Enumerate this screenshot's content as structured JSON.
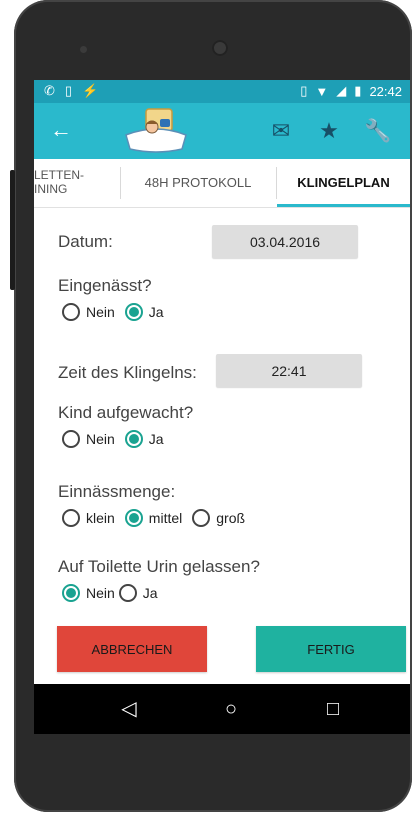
{
  "status_bar": {
    "time": "22:42",
    "left_icons": [
      "call-forward-icon",
      "sd-card-icon",
      "no-flash-icon"
    ],
    "right_icons": [
      "vibrate-icon",
      "wifi-icon",
      "signal-icon",
      "battery-icon"
    ]
  },
  "app_bar": {
    "back_icon": "arrow-left-icon",
    "logo": "bed-child-logo",
    "actions": [
      "mail-icon",
      "star-icon",
      "wrench-icon"
    ]
  },
  "tabs": [
    {
      "label": "LETTEN-\nINING"
    },
    {
      "label": "48H PROTOKOLL"
    },
    {
      "label": "KLINGELPLAN"
    }
  ],
  "form": {
    "datum_label": "Datum:",
    "datum_value": "03.04.2016",
    "eingenaesst_label": "Eingenässt?",
    "eingenaesst_options": [
      "Nein",
      "Ja"
    ],
    "eingenaesst_selected": "Ja",
    "zeit_label": "Zeit des Klingelns:",
    "zeit_value": "22:41",
    "aufgewacht_label": "Kind aufgewacht?",
    "aufgewacht_options": [
      "Nein",
      "Ja"
    ],
    "aufgewacht_selected": "Ja",
    "menge_label": "Einnässmenge:",
    "menge_options": [
      "klein",
      "mittel",
      "groß"
    ],
    "menge_selected": "mittel",
    "toilette_label": "Auf Toilette Urin gelassen?",
    "toilette_options": [
      "Nein",
      "Ja"
    ],
    "toilette_selected": "Nein"
  },
  "buttons": {
    "cancel_label": "ABBRECHEN",
    "done_label": "FERTIG"
  },
  "colors": {
    "app_bar": "#2ab9cc",
    "status_bar": "#1e9fb6",
    "accent": "#1aa391",
    "cancel_button": "#e0463a",
    "done_button": "#1fb2a0"
  },
  "nav_bar": {
    "icons": [
      "back-triangle-icon",
      "home-circle-icon",
      "recents-square-icon"
    ]
  }
}
